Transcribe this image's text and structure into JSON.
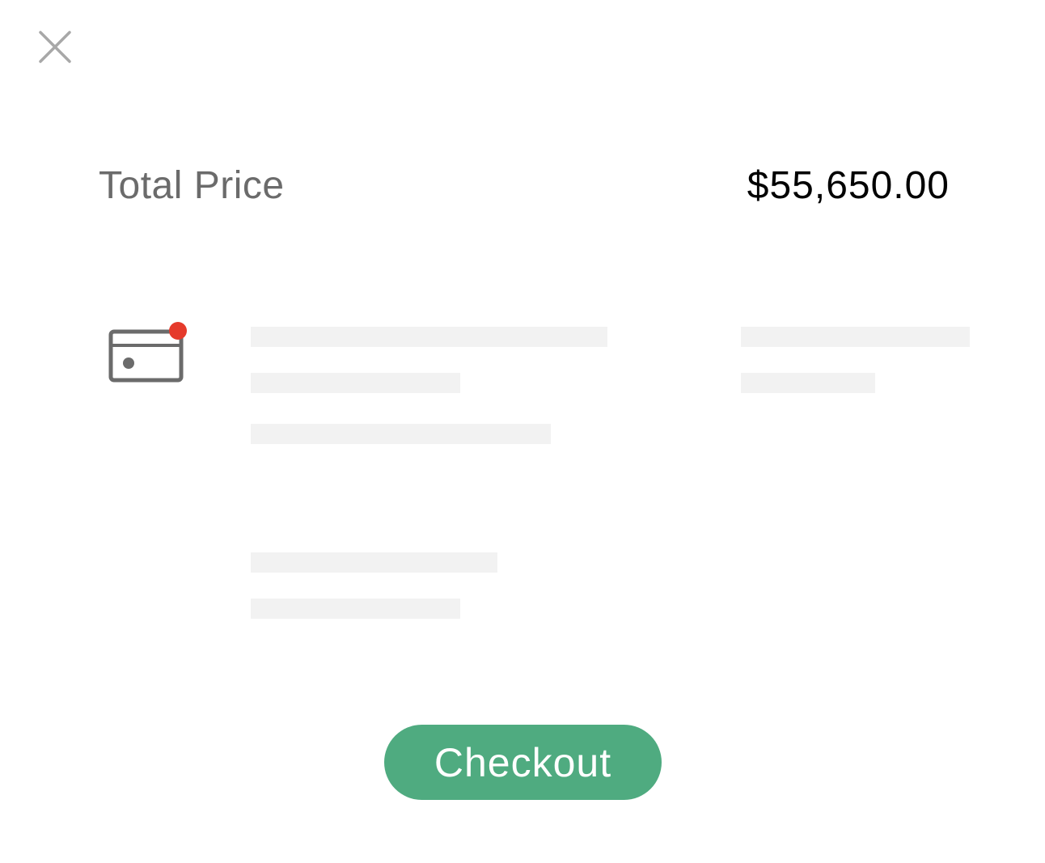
{
  "header": {
    "close_icon": "close-icon"
  },
  "summary": {
    "total_label": "Total Price",
    "total_value": "$55,650.00"
  },
  "payment": {
    "icon": "credit-card-icon",
    "notification_dot_color": "#e53a2b",
    "icon_color": "#6b6b6b"
  },
  "actions": {
    "checkout_label": "Checkout",
    "checkout_color": "#4fab80"
  }
}
